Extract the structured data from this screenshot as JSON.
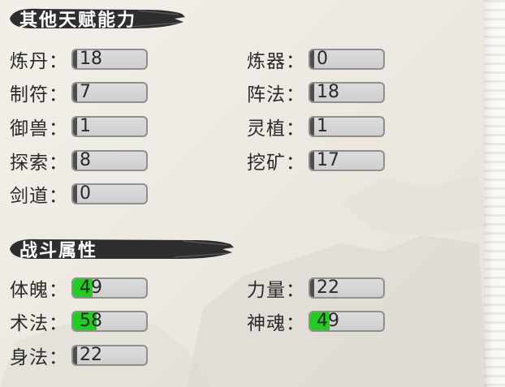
{
  "colors": {
    "background": "#ece8e1",
    "header_brush": "#2e2e2e",
    "bar_dark": "#4e4e4e",
    "bar_green": "#22cc22",
    "box_fill": "#d4d4d4"
  },
  "talents": {
    "title": "其他天赋能力",
    "items": [
      {
        "label": "炼丹",
        "value": "18",
        "bar": "dark",
        "fill": 0.05
      },
      {
        "label": "炼器",
        "value": "0",
        "bar": "dark",
        "fill": 0.05
      },
      {
        "label": "制符",
        "value": "7",
        "bar": "dark",
        "fill": 0.05
      },
      {
        "label": "阵法",
        "value": "18",
        "bar": "dark",
        "fill": 0.05
      },
      {
        "label": "御兽",
        "value": "1",
        "bar": "dark",
        "fill": 0.05
      },
      {
        "label": "灵植",
        "value": "1",
        "bar": "dark",
        "fill": 0.05
      },
      {
        "label": "探索",
        "value": "8",
        "bar": "dark",
        "fill": 0.05
      },
      {
        "label": "挖矿",
        "value": "17",
        "bar": "dark",
        "fill": 0.05
      },
      {
        "label": "剑道",
        "value": "0",
        "bar": "dark",
        "fill": 0.05
      }
    ]
  },
  "combat": {
    "title": "战斗属性",
    "items": [
      {
        "label": "体魄",
        "value": "49",
        "bar": "green",
        "fill": 0.27
      },
      {
        "label": "力量",
        "value": "22",
        "bar": "dark",
        "fill": 0.05
      },
      {
        "label": "术法",
        "value": "58",
        "bar": "green",
        "fill": 0.32
      },
      {
        "label": "神魂",
        "value": "49",
        "bar": "green",
        "fill": 0.27
      },
      {
        "label": "身法",
        "value": "22",
        "bar": "dark",
        "fill": 0.05
      }
    ]
  },
  "label_separator": "："
}
